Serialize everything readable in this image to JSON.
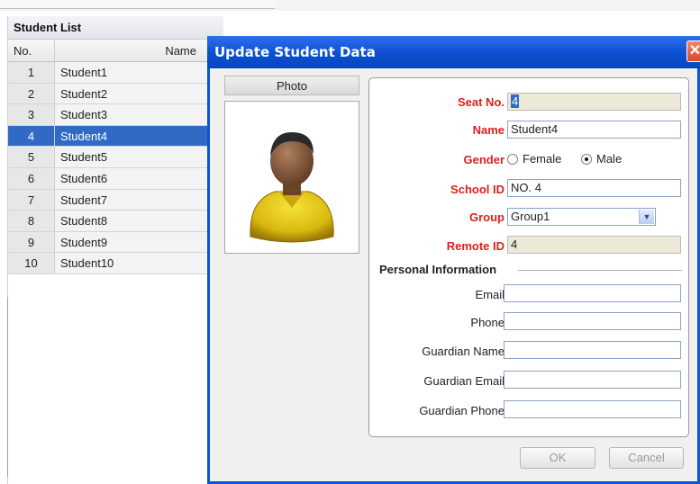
{
  "student_list": {
    "title": "Student List",
    "columns": [
      "No.",
      "Name"
    ],
    "rows": [
      {
        "no": "1",
        "name": "Student1"
      },
      {
        "no": "2",
        "name": "Student2"
      },
      {
        "no": "3",
        "name": "Student3"
      },
      {
        "no": "4",
        "name": "Student4",
        "selected": true
      },
      {
        "no": "5",
        "name": "Student5"
      },
      {
        "no": "6",
        "name": "Student6"
      },
      {
        "no": "7",
        "name": "Student7"
      },
      {
        "no": "8",
        "name": "Student8"
      },
      {
        "no": "9",
        "name": "Student9"
      },
      {
        "no": "10",
        "name": "Student10"
      }
    ]
  },
  "dialog": {
    "title": "Update Student Data",
    "close_icon": "close-icon",
    "photo_label": "Photo",
    "photo_icon": "student-avatar-icon",
    "fields": {
      "seat_no": {
        "label": "Seat No.",
        "value": "4"
      },
      "name": {
        "label": "Name",
        "value": "Student4"
      },
      "gender": {
        "label": "Gender",
        "options": [
          "Female",
          "Male"
        ],
        "selected": "Male"
      },
      "school_id": {
        "label": "School ID",
        "value": "NO. 4"
      },
      "group": {
        "label": "Group",
        "value": "Group1"
      },
      "remote_id": {
        "label": "Remote ID",
        "value": "4"
      }
    },
    "personal_info": {
      "title": "Personal Information",
      "email": {
        "label": "Email",
        "value": ""
      },
      "phone": {
        "label": "Phone",
        "value": ""
      },
      "guardian_name": {
        "label": "Guardian Name",
        "value": ""
      },
      "guardian_email": {
        "label": "Guardian Email",
        "value": ""
      },
      "guardian_phone": {
        "label": "Guardian Phone",
        "value": ""
      }
    },
    "ok_label": "OK",
    "cancel_label": "Cancel"
  },
  "colors": {
    "titlebar": "#0b4fd0",
    "selection": "#316ac5",
    "required_label": "#dd1f1f"
  }
}
